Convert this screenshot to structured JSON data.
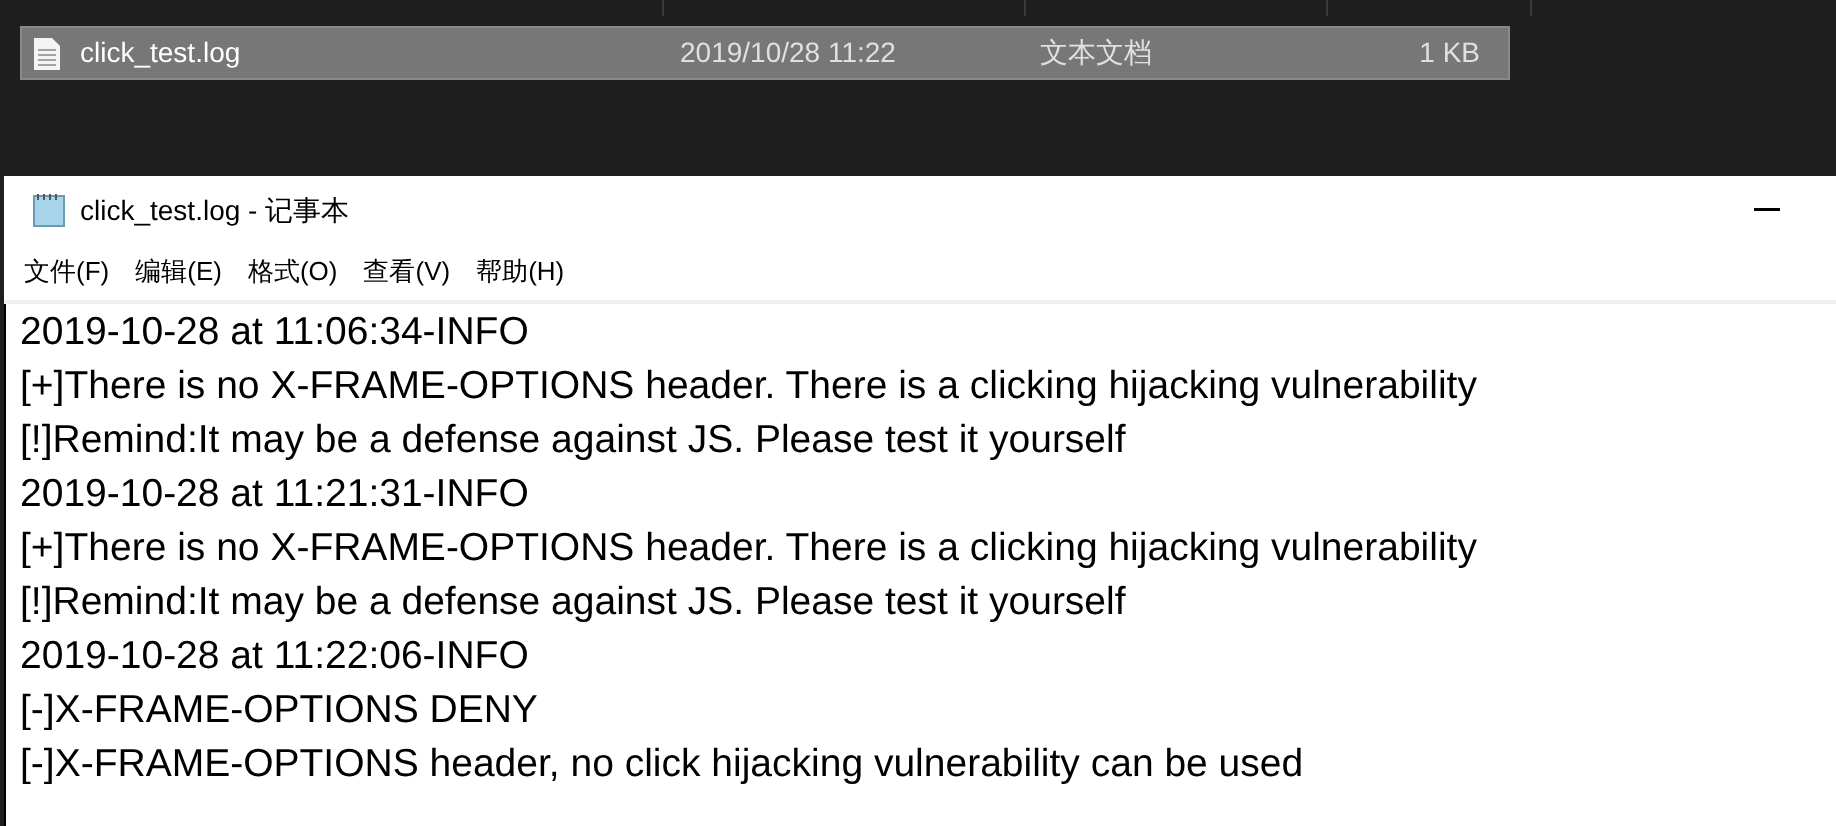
{
  "explorer_row": {
    "name": "click_test.log",
    "modified": "2019/10/28 11:22",
    "type": "文本文档",
    "size": "1 KB",
    "selected": true
  },
  "window": {
    "title": "click_test.log - 记事本"
  },
  "menu": [
    "文件(F)",
    "编辑(E)",
    "格式(O)",
    "查看(V)",
    "帮助(H)"
  ],
  "lines": [
    "2019-10-28 at 11:06:34-INFO",
    "[+]There is no X-FRAME-OPTIONS header. There is a clicking hijacking vulnerability",
    "[!]Remind:It may be a defense against JS. Please test it yourself",
    "2019-10-28 at 11:21:31-INFO",
    "[+]There is no X-FRAME-OPTIONS header. There is a clicking hijacking vulnerability",
    "[!]Remind:It may be a defense against JS. Please test it yourself",
    "2019-10-28 at 11:22:06-INFO",
    "[-]X-FRAME-OPTIONS DENY",
    "[-]X-FRAME-OPTIONS header, no click hijacking vulnerability can be used"
  ]
}
